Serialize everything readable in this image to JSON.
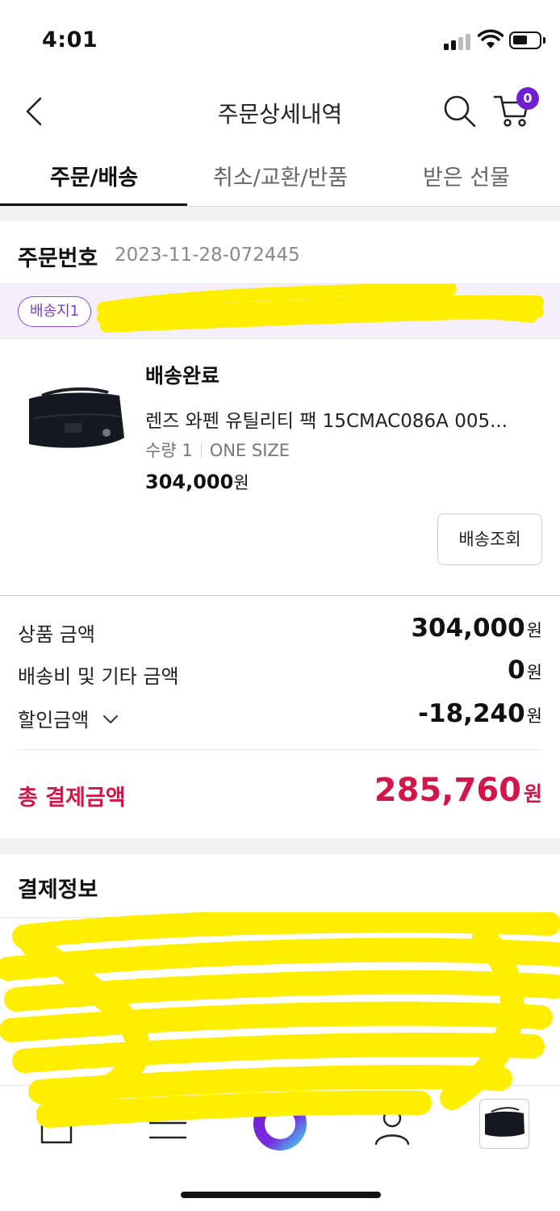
{
  "status_bar": {
    "time": "4:01"
  },
  "header": {
    "title": "주문상세내역",
    "cart_count": "0"
  },
  "tabs": [
    {
      "label": "주문/배송",
      "active": true
    },
    {
      "label": "취소/교환/반품",
      "active": false
    },
    {
      "label": "받은 선물",
      "active": false
    }
  ],
  "order": {
    "number_label": "주문번호",
    "number": "2023-11-28-072445"
  },
  "destination": {
    "badge": "배송지1"
  },
  "product": {
    "status": "배송완료",
    "name": "렌즈 와펜 유틸리티 팩 15CMAC086A 005...",
    "quantity": "수량 1",
    "size": "ONE SIZE",
    "price": "304,000",
    "price_unit": "원",
    "track_button": "배송조회"
  },
  "summary": {
    "product_amount_label": "상품 금액",
    "product_amount": "304,000",
    "shipping_label": "배송비 및 기타 금액",
    "shipping_amount": "0",
    "discount_label": "할인금액",
    "discount_amount": "-18,240",
    "unit": "원",
    "total_label": "총 결제금액",
    "total_amount": "285,760"
  },
  "payment_info": {
    "title": "결제정보"
  },
  "colors": {
    "accent_purple": "#6f1fd0",
    "total_red": "#d3164a",
    "redaction_yellow": "#ffee00"
  }
}
